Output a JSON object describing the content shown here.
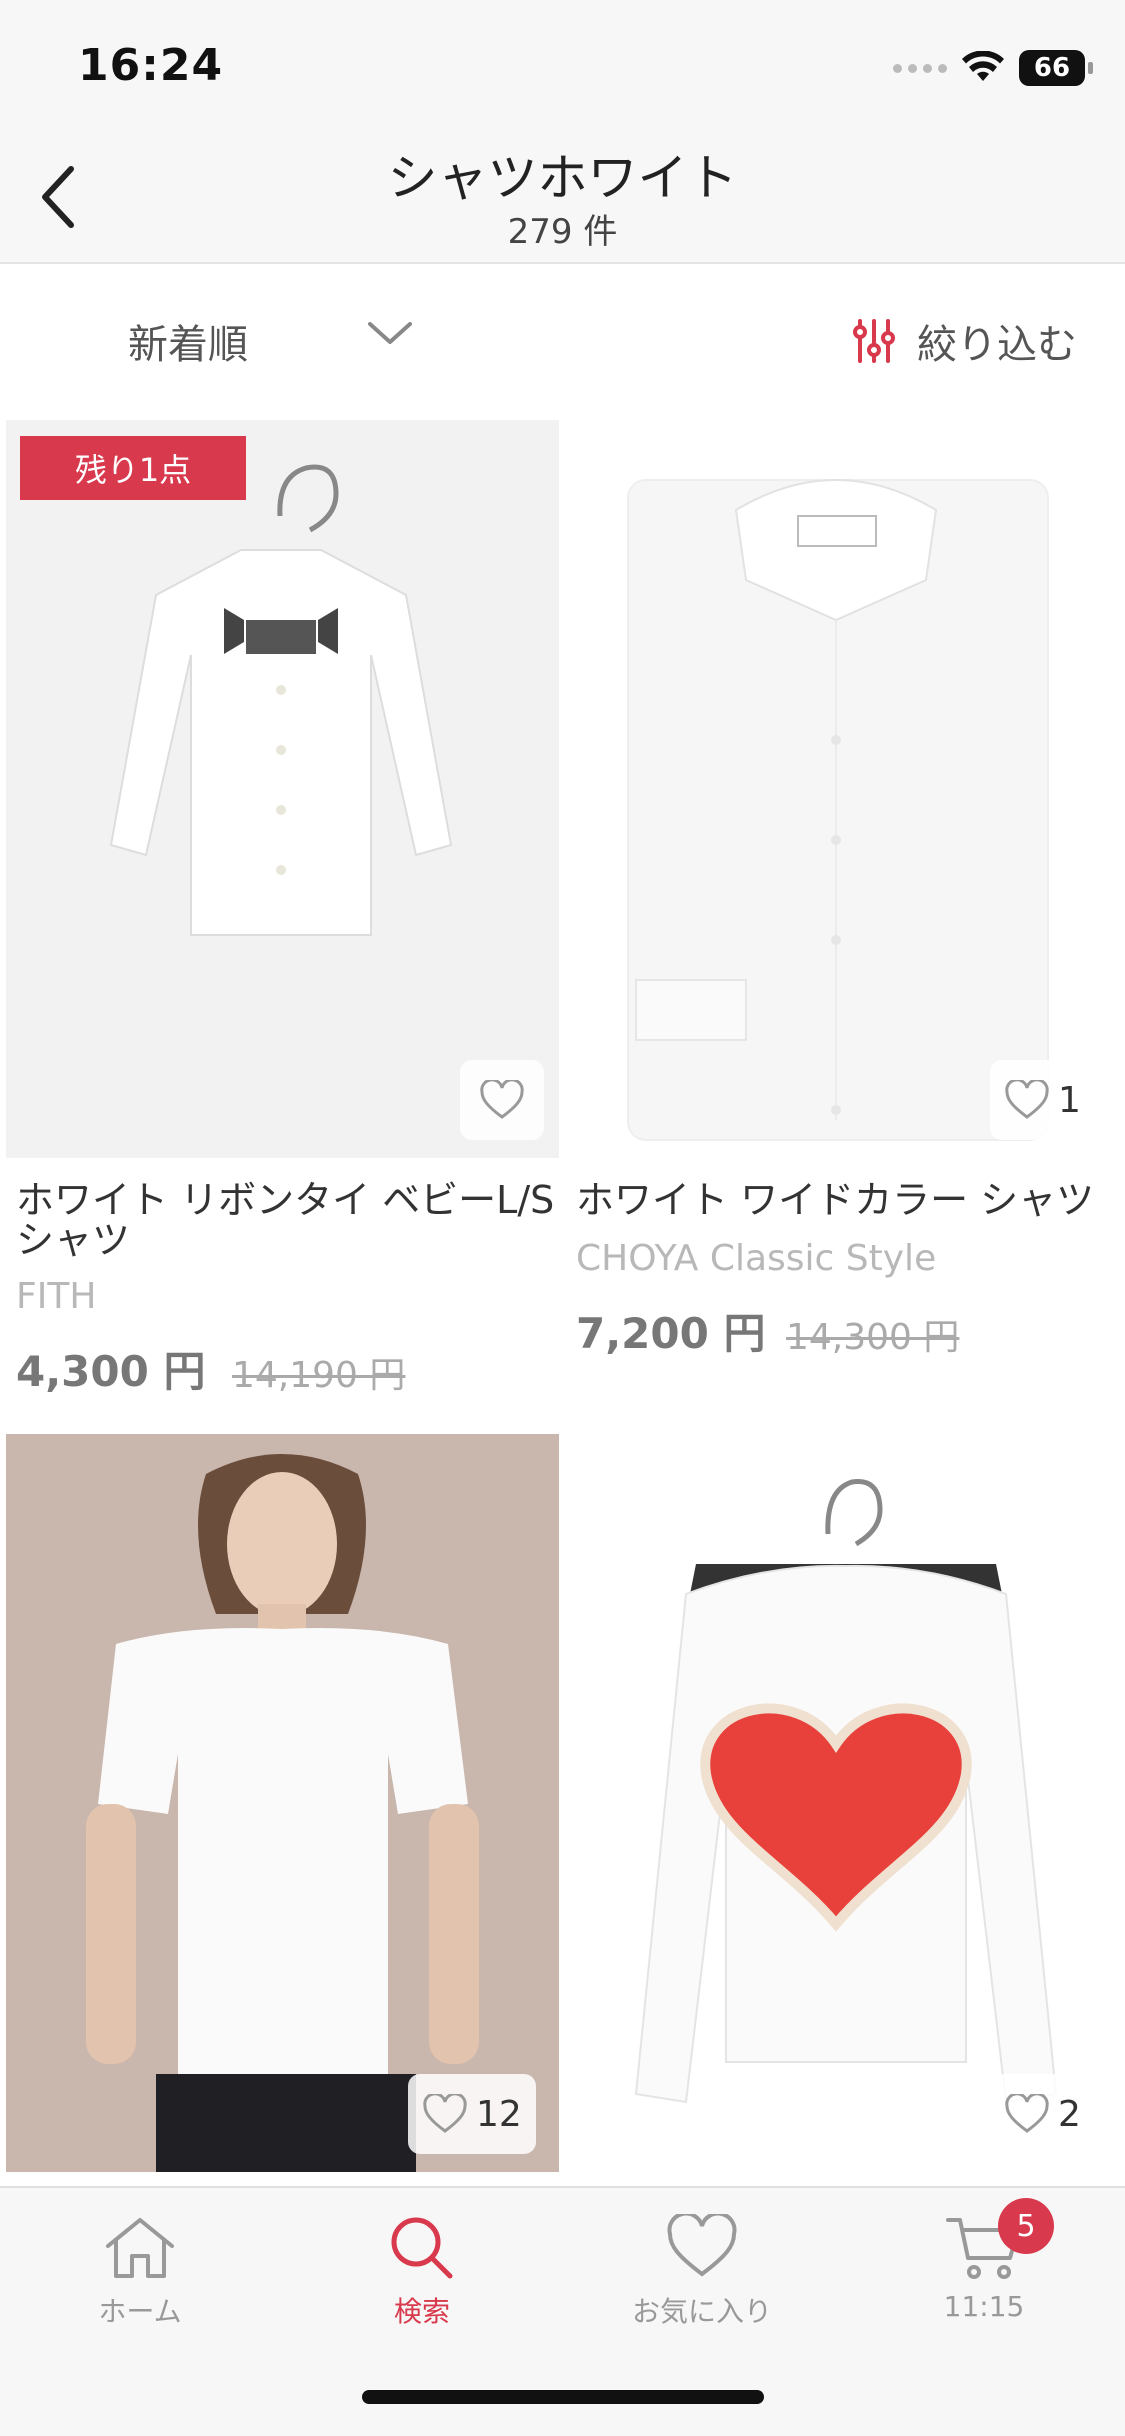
{
  "status": {
    "time": "16:24",
    "battery": "66"
  },
  "header": {
    "title": "シャツホワイト",
    "count": "279 件"
  },
  "toolbar": {
    "sort_label": "新着順",
    "filter_label": "絞り込む"
  },
  "products": [
    {
      "badge": "残り1点",
      "name": "ホワイト リボンタイ ベビーL/Sシャツ",
      "brand": "FITH",
      "price": "4,300 円",
      "original_price": "14,190 円",
      "favorites": ""
    },
    {
      "name": "ホワイト ワイドカラー シャツ",
      "brand": "CHOYA Classic Style",
      "price": "7,200 円",
      "original_price": "14,300 円",
      "favorites": "1"
    },
    {
      "favorites": "12"
    },
    {
      "favorites": "2"
    }
  ],
  "tabbar": {
    "home": "ホーム",
    "search": "検索",
    "favorites": "お気に入り",
    "cart": "11:15",
    "cart_count": "5"
  },
  "colors": {
    "accent": "#d9394c",
    "text": "#333333",
    "muted": "#999999"
  }
}
